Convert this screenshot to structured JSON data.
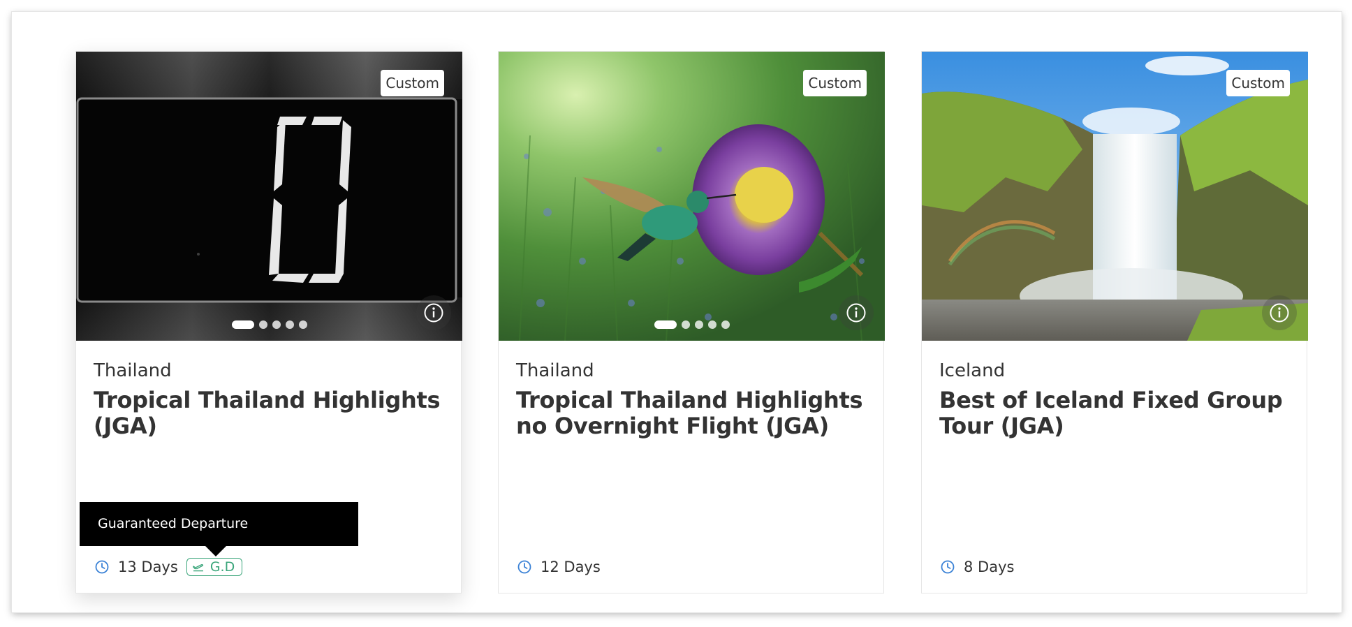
{
  "colors": {
    "accent_blue": "#3b82d6",
    "gd_green": "#3aa57a",
    "text_dark": "#333333",
    "tooltip_bg": "#000000"
  },
  "tooltip": {
    "text": "Guaranteed Departure"
  },
  "cards": [
    {
      "badge": "Custom",
      "country": "Thailand",
      "title": "Tropical Thailand Highlights (JGA)",
      "duration": "13 Days",
      "gd_label": "G.D",
      "image": "black-digital-zero-display",
      "carousel_dots": 5,
      "active_dot": 1,
      "info_icon": "info-icon"
    },
    {
      "badge": "Custom",
      "country": "Thailand",
      "title": "Tropical Thailand Highlights no Overnight Flight (JGA)",
      "duration": "12 Days",
      "image": "hummingbird-purple-flower",
      "carousel_dots": 5,
      "active_dot": 1,
      "info_icon": "info-icon"
    },
    {
      "badge": "Custom",
      "country": "Iceland",
      "title": "Best of Iceland Fixed Group Tour (JGA)",
      "duration": "8 Days",
      "image": "iceland-waterfall-rainbow",
      "info_icon": "info-icon"
    }
  ]
}
